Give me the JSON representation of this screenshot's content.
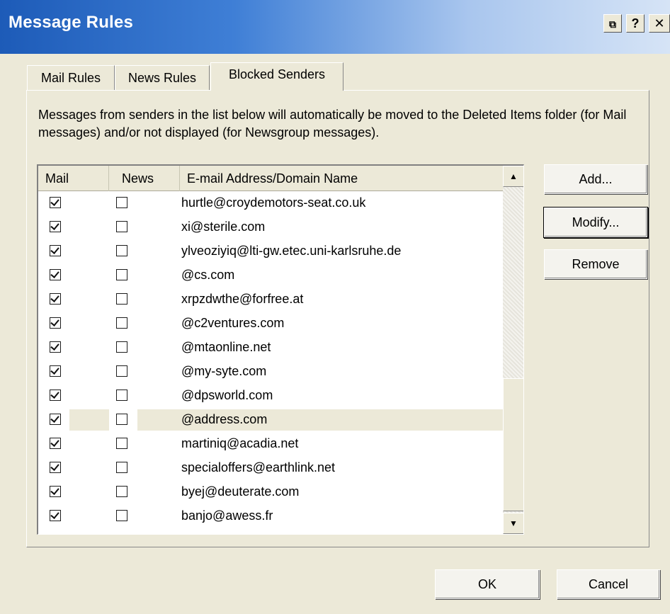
{
  "window": {
    "title": "Message Rules",
    "buttons": {
      "pin_glyph": "⧉",
      "help_glyph": "?",
      "close_glyph": "✕"
    }
  },
  "tabs": [
    {
      "label": "Mail Rules",
      "active": false
    },
    {
      "label": "News Rules",
      "active": false
    },
    {
      "label": "Blocked Senders",
      "active": true
    }
  ],
  "panel": {
    "description": "Messages from senders in the list below will automatically be moved to the Deleted Items folder (for Mail messages) and/or not displayed (for Newsgroup messages).",
    "columns": [
      "Mail",
      "News",
      "E-mail Address/Domain Name"
    ],
    "rows": [
      {
        "mail": true,
        "news": false,
        "address": "hurtle@croydemotors-seat.co.uk"
      },
      {
        "mail": true,
        "news": false,
        "address": "xi@sterile.com"
      },
      {
        "mail": true,
        "news": false,
        "address": "ylveoziyiq@lti-gw.etec.uni-karlsruhe.de"
      },
      {
        "mail": true,
        "news": false,
        "address": "@cs.com"
      },
      {
        "mail": true,
        "news": false,
        "address": "xrpzdwthe@forfree.at"
      },
      {
        "mail": true,
        "news": false,
        "address": "@c2ventures.com"
      },
      {
        "mail": true,
        "news": false,
        "address": "@mtaonline.net"
      },
      {
        "mail": true,
        "news": false,
        "address": "@my-syte.com"
      },
      {
        "mail": true,
        "news": false,
        "address": "@dpsworld.com"
      },
      {
        "mail": true,
        "news": false,
        "address": "@address.com",
        "selected": true
      },
      {
        "mail": true,
        "news": false,
        "address": "martiniq@acadia.net"
      },
      {
        "mail": true,
        "news": false,
        "address": "specialoffers@earthlink.net"
      },
      {
        "mail": true,
        "news": false,
        "address": "byej@deuterate.com"
      },
      {
        "mail": true,
        "news": false,
        "address": "banjo@awess.fr"
      }
    ],
    "side_buttons": {
      "add": "Add...",
      "modify": "Modify...",
      "remove": "Remove"
    }
  },
  "footer": {
    "ok": "OK",
    "cancel": "Cancel"
  }
}
